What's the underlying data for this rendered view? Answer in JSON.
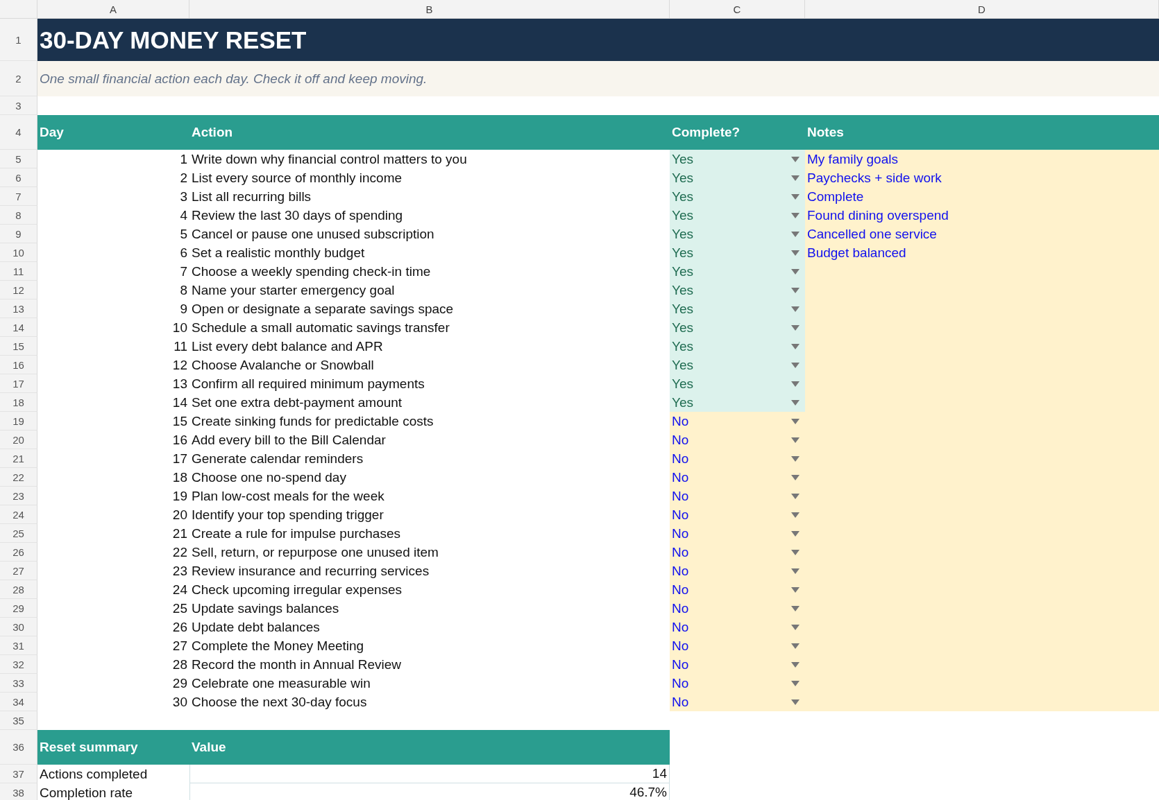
{
  "column_letters": [
    "A",
    "B",
    "C",
    "D"
  ],
  "row_numbers": [
    "1",
    "2",
    "3",
    "4",
    "5",
    "6",
    "7",
    "8",
    "9",
    "10",
    "11",
    "12",
    "13",
    "14",
    "15",
    "16",
    "17",
    "18",
    "19",
    "20",
    "21",
    "22",
    "23",
    "24",
    "25",
    "26",
    "27",
    "28",
    "29",
    "30",
    "31",
    "32",
    "33",
    "34",
    "35",
    "36",
    "37",
    "38"
  ],
  "title": "30-DAY MONEY RESET",
  "subtitle": "One small financial action each day. Check it off and keep moving.",
  "table": {
    "headers": [
      "Day",
      "Action",
      "Complete?",
      "Notes"
    ],
    "rows": [
      {
        "day": "1",
        "action": "Write down why financial control matters to you",
        "complete": "Yes",
        "done": true,
        "notes": "My family goals"
      },
      {
        "day": "2",
        "action": "List every source of monthly income",
        "complete": "Yes",
        "done": true,
        "notes": "Paychecks + side work"
      },
      {
        "day": "3",
        "action": "List all recurring bills",
        "complete": "Yes",
        "done": true,
        "notes": "Complete"
      },
      {
        "day": "4",
        "action": "Review the last 30 days of spending",
        "complete": "Yes",
        "done": true,
        "notes": "Found dining overspend"
      },
      {
        "day": "5",
        "action": "Cancel or pause one unused subscription",
        "complete": "Yes",
        "done": true,
        "notes": "Cancelled one service"
      },
      {
        "day": "6",
        "action": "Set a realistic monthly budget",
        "complete": "Yes",
        "done": true,
        "notes": "Budget balanced"
      },
      {
        "day": "7",
        "action": "Choose a weekly spending check-in time",
        "complete": "Yes",
        "done": true
      },
      {
        "day": "8",
        "action": "Name your starter emergency goal",
        "complete": "Yes",
        "done": true
      },
      {
        "day": "9",
        "action": "Open or designate a separate savings space",
        "complete": "Yes",
        "done": true
      },
      {
        "day": "10",
        "action": "Schedule a small automatic savings transfer",
        "complete": "Yes",
        "done": true
      },
      {
        "day": "11",
        "action": "List every debt balance and APR",
        "complete": "Yes",
        "done": true
      },
      {
        "day": "12",
        "action": "Choose Avalanche or Snowball",
        "complete": "Yes",
        "done": true
      },
      {
        "day": "13",
        "action": "Confirm all required minimum payments",
        "complete": "Yes",
        "done": true
      },
      {
        "day": "14",
        "action": "Set one extra debt-payment amount",
        "complete": "Yes",
        "done": true
      },
      {
        "day": "15",
        "action": "Create sinking funds for predictable costs",
        "complete": "No",
        "done": false
      },
      {
        "day": "16",
        "action": "Add every bill to the Bill Calendar",
        "complete": "No",
        "done": false
      },
      {
        "day": "17",
        "action": "Generate calendar reminders",
        "complete": "No",
        "done": false
      },
      {
        "day": "18",
        "action": "Choose one no-spend day",
        "complete": "No",
        "done": false
      },
      {
        "day": "19",
        "action": "Plan low-cost meals for the week",
        "complete": "No",
        "done": false
      },
      {
        "day": "20",
        "action": "Identify your top spending trigger",
        "complete": "No",
        "done": false
      },
      {
        "day": "21",
        "action": "Create a rule for impulse purchases",
        "complete": "No",
        "done": false
      },
      {
        "day": "22",
        "action": "Sell, return, or repurpose one unused item",
        "complete": "No",
        "done": false
      },
      {
        "day": "23",
        "action": "Review insurance and recurring services",
        "complete": "No",
        "done": false
      },
      {
        "day": "24",
        "action": "Check upcoming irregular expenses",
        "complete": "No",
        "done": false
      },
      {
        "day": "25",
        "action": "Update savings balances",
        "complete": "No",
        "done": false
      },
      {
        "day": "26",
        "action": "Update debt balances",
        "complete": "No",
        "done": false
      },
      {
        "day": "27",
        "action": "Complete the Money Meeting",
        "complete": "No",
        "done": false
      },
      {
        "day": "28",
        "action": "Record the month in Annual Review",
        "complete": "No",
        "done": false
      },
      {
        "day": "29",
        "action": "Celebrate one measurable win",
        "complete": "No",
        "done": false
      },
      {
        "day": "30",
        "action": "Choose the next 30-day focus",
        "complete": "No",
        "done": false
      }
    ]
  },
  "summary": {
    "headers": [
      "Reset summary",
      "Value"
    ],
    "rows": [
      {
        "label": "Actions completed",
        "value": "14"
      },
      {
        "label": "Completion rate",
        "value": "46.7%"
      }
    ]
  }
}
